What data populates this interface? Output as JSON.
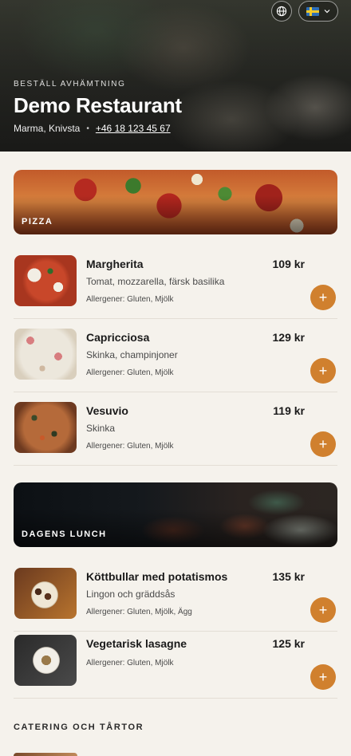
{
  "header": {
    "eyebrow": "BESTÄLL AVHÄMTNING",
    "title": "Demo Restaurant",
    "location": "Marma, Knivsta",
    "separator": "•",
    "phone": "+46 18 123 45 67",
    "language_icon": "globe-icon",
    "language_flag": "swedish-flag-icon"
  },
  "categories": [
    {
      "label": "PIZZA",
      "items": [
        {
          "name": "Margherita",
          "price": "109 kr",
          "desc": "Tomat, mozzarella, färsk basilika",
          "allergens": "Allergener: Gluten, Mjölk"
        },
        {
          "name": "Capricciosa",
          "price": "129 kr",
          "desc": "Skinka, champinjoner",
          "allergens": "Allergener: Gluten, Mjölk"
        },
        {
          "name": "Vesuvio",
          "price": "119 kr",
          "desc": "Skinka",
          "allergens": "Allergener: Gluten, Mjölk"
        }
      ]
    },
    {
      "label": "DAGENS LUNCH",
      "items": [
        {
          "name": "Köttbullar med potatismos",
          "price": "135 kr",
          "desc": "Lingon och gräddsås",
          "allergens": "Allergener: Gluten, Mjölk, Ägg"
        },
        {
          "name": "Vegetarisk lasagne",
          "price": "125 kr",
          "allergens": "Allergener: Gluten, Mjölk"
        }
      ]
    }
  ],
  "next_section": "CATERING OCH TÅRTOR",
  "add_symbol": "+",
  "colors": {
    "accent": "#d0802e",
    "background": "#f5f2ec"
  }
}
